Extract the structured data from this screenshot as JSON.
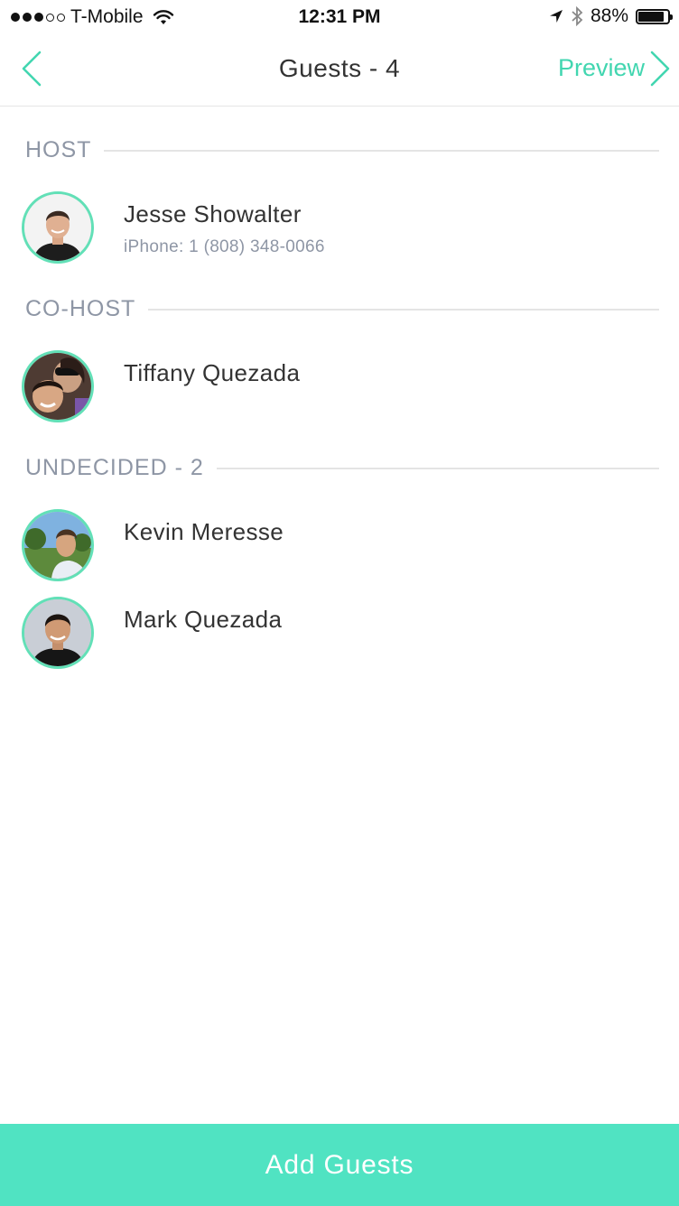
{
  "status_bar": {
    "carrier": "T-Mobile",
    "time": "12:31 PM",
    "battery": "88%",
    "battery_level": 0.88,
    "signal_bars_filled": 3,
    "signal_bars_total": 5
  },
  "nav": {
    "title": "Guests - 4",
    "preview_label": "Preview",
    "accent_color": "#42d6b0"
  },
  "sections": {
    "host": {
      "label": "HOST",
      "guests": [
        {
          "name": "Jesse Showalter",
          "sub": "iPhone: 1 (808) 348-0066"
        }
      ]
    },
    "cohost": {
      "label": "CO-HOST",
      "guests": [
        {
          "name": "Tiffany Quezada"
        }
      ]
    },
    "undecided": {
      "label": "UNDECIDED - 2",
      "guests": [
        {
          "name": "Kevin Meresse"
        },
        {
          "name": "Mark Quezada"
        }
      ]
    }
  },
  "add_guests_label": "Add Guests",
  "colors": {
    "button_bg": "#50e3c2",
    "avatar_ring": "#62e0b7",
    "section_label": "#8e96a5"
  }
}
